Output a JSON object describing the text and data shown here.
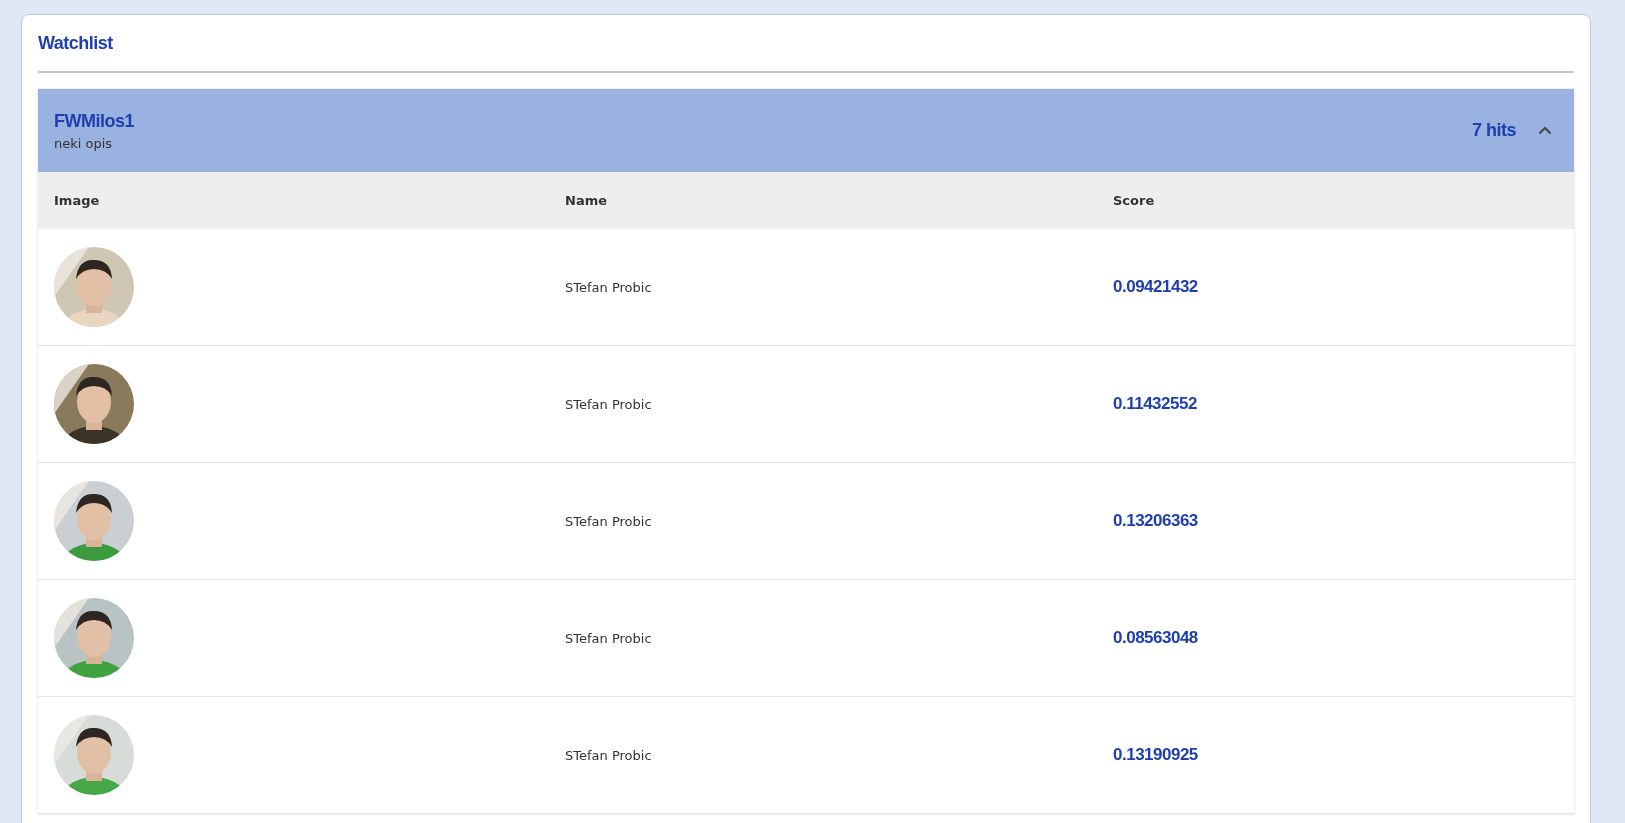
{
  "panel": {
    "title": "Watchlist"
  },
  "group": {
    "name": "FWMilos1",
    "description": "neki opis",
    "hits": "7 hits",
    "expanded": true
  },
  "table": {
    "columns": [
      "Image",
      "Name",
      "Score"
    ],
    "rows": [
      {
        "name": "STefan Probic",
        "score": "0.09421432"
      },
      {
        "name": "STefan Probic",
        "score": "0.11432552"
      },
      {
        "name": "STefan Probic",
        "score": "0.13206363"
      },
      {
        "name": "STefan Probic",
        "score": "0.08563048"
      },
      {
        "name": "STefan Probic",
        "score": "0.13190925"
      }
    ]
  }
}
